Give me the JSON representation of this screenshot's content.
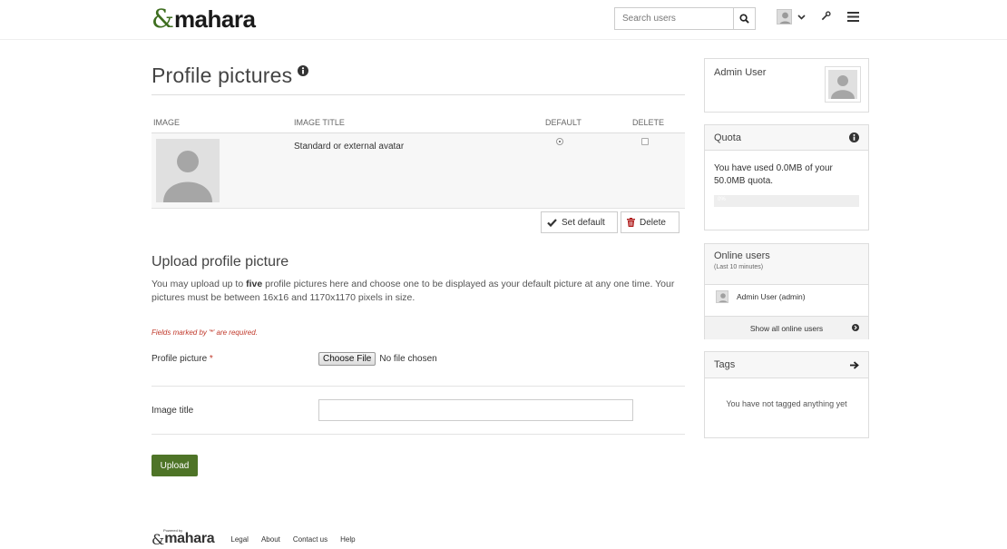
{
  "header": {
    "logo_mark": "&",
    "logo_text": "mahara",
    "search_placeholder": "Search users"
  },
  "main": {
    "title": "Profile pictures",
    "table": {
      "headers": [
        "IMAGE",
        "IMAGE TITLE",
        "DEFAULT",
        "DELETE"
      ],
      "rows": [
        {
          "title": "Standard or external avatar",
          "default": true,
          "delete": false
        }
      ]
    },
    "set_default_label": "Set default",
    "delete_label": "Delete",
    "upload_heading": "Upload profile picture",
    "upload_desc_pre": "You may upload up to ",
    "upload_desc_bold": "five",
    "upload_desc_post": " profile pictures here and choose one to be displayed as your default picture at any one time. Your pictures must be between 16x16 and 1170x1170 pixels in size.",
    "required_note": "Fields marked by '*' are required.",
    "profile_picture_label": "Profile picture",
    "required_star": "*",
    "choose_file_label": "Choose File",
    "no_file_text": "No file chosen",
    "image_title_label": "Image title",
    "image_title_value": "",
    "upload_label": "Upload"
  },
  "sidebar": {
    "user_name": "Admin User",
    "quota": {
      "title": "Quota",
      "text": "You have used 0.0MB of your 50.0MB quota.",
      "used_fraction": 0.0,
      "percent_label": "0%"
    },
    "online": {
      "title": "Online users",
      "subtitle": "(Last 10 minutes)",
      "users": [
        "Admin User (admin)"
      ],
      "show_all_label": "Show all online users"
    },
    "tags": {
      "title": "Tags",
      "empty_text": "You have not tagged anything yet"
    }
  },
  "footer": {
    "powered_by": "Powered by",
    "logo_mark": "&",
    "logo_text": "mahara",
    "links": [
      "Legal",
      "About",
      "Contact us",
      "Help"
    ]
  },
  "colors": {
    "brand_green": "#4e7427",
    "required_red": "#c0392b",
    "panel_header_bg": "#f7f7f7"
  },
  "icons": [
    "info-icon",
    "search-icon",
    "user-avatar-icon",
    "chevron-down-icon",
    "wrench-icon",
    "hamburger-menu-icon",
    "check-icon",
    "trash-icon",
    "arrow-circle-right-icon",
    "arrow-right-icon"
  ]
}
